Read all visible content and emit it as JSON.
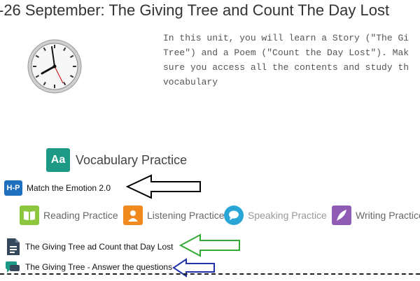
{
  "page": {
    "title": "-26 September: The Giving Tree and Count The Day Lost",
    "intro": "In this unit, you will learn a Story (\"The Gi\nTree\") and a Poem (\"Count the Day Lost\"). Mak\nsure you access all the contents and study th\nvocabulary"
  },
  "vocab": {
    "icon_text": "Aa",
    "label": "Vocabulary Practice",
    "color": "#1c9a86"
  },
  "activities": {
    "h5p": {
      "icon_text": "H-P",
      "label": "Match the Emotion 2.0",
      "icon": "h5p-icon",
      "color": "#1f6fbf"
    },
    "doc": {
      "label": "The Giving Tree ad Count that Day Lost",
      "icon": "document-icon"
    },
    "forum": {
      "label": "The Giving Tree - Answer the questions",
      "icon": "forum-icon"
    }
  },
  "practices": [
    {
      "label": "Reading Practice",
      "icon": "book-icon",
      "color": "#8cc63f"
    },
    {
      "label": "Listening Practice",
      "icon": "listener-icon",
      "color": "#f08a1e"
    },
    {
      "label": "Speaking Practice",
      "icon": "speech-bubble-icon",
      "color": "#2aa6d6"
    },
    {
      "label": "Writing Practice",
      "icon": "quill-icon",
      "color": "#8e5bb5"
    }
  ],
  "annotation_colors": {
    "black_arrow": "#000000",
    "green_arrow": "#33aa33",
    "blue_arrow": "#2233aa"
  }
}
